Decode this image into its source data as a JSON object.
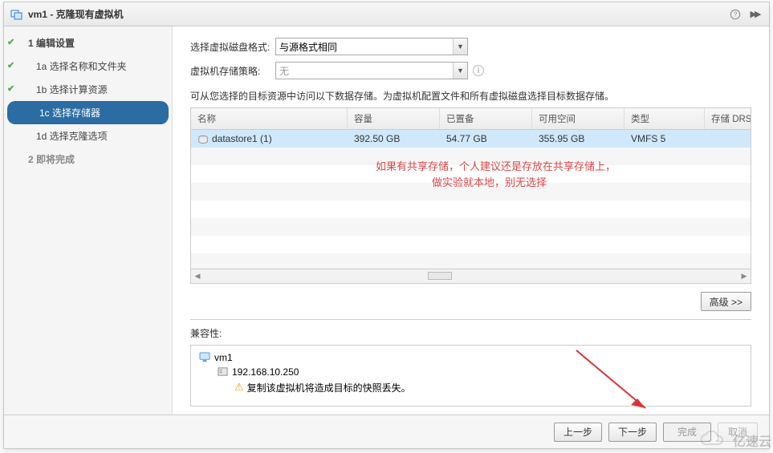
{
  "title": "vm1 - 克隆现有虚拟机",
  "sidebar": {
    "top": "1 编辑设置",
    "s1a": "1a 选择名称和文件夹",
    "s1b": "1b 选择计算资源",
    "s1c": "1c 选择存储器",
    "s1d": "1d 选择克隆选项",
    "s2": "2 即将完成"
  },
  "form": {
    "disk_format_label": "选择虚拟磁盘格式:",
    "disk_format_value": "与源格式相同",
    "policy_label": "虚拟机存储策略:",
    "policy_value": "无",
    "desc": "可从您选择的目标资源中访问以下数据存储。为虚拟机配置文件和所有虚拟磁盘选择目标数据存储。"
  },
  "table": {
    "h_name": "名称",
    "h_cap": "容量",
    "h_prov": "已置备",
    "h_free": "可用空间",
    "h_type": "类型",
    "h_drs": "存储 DRS",
    "row": {
      "name": "datastore1 (1)",
      "cap": "392.50 GB",
      "prov": "54.77 GB",
      "free": "355.95 GB",
      "type": "VMFS 5",
      "drs": ""
    }
  },
  "overlay": {
    "l1": "如果有共享存储，个人建议还是存放在共享存储上，",
    "l2": "做实验就本地，别无选择"
  },
  "adv_btn": "高级 >>",
  "compat_label": "兼容性:",
  "tree": {
    "vm": "vm1",
    "host": "192.168.10.250",
    "warn": "复制该虚拟机将造成目标的快照丢失。"
  },
  "footer": {
    "back": "上一步",
    "next": "下一步",
    "finish": "完成",
    "cancel": "取消"
  },
  "watermark": "亿速云"
}
